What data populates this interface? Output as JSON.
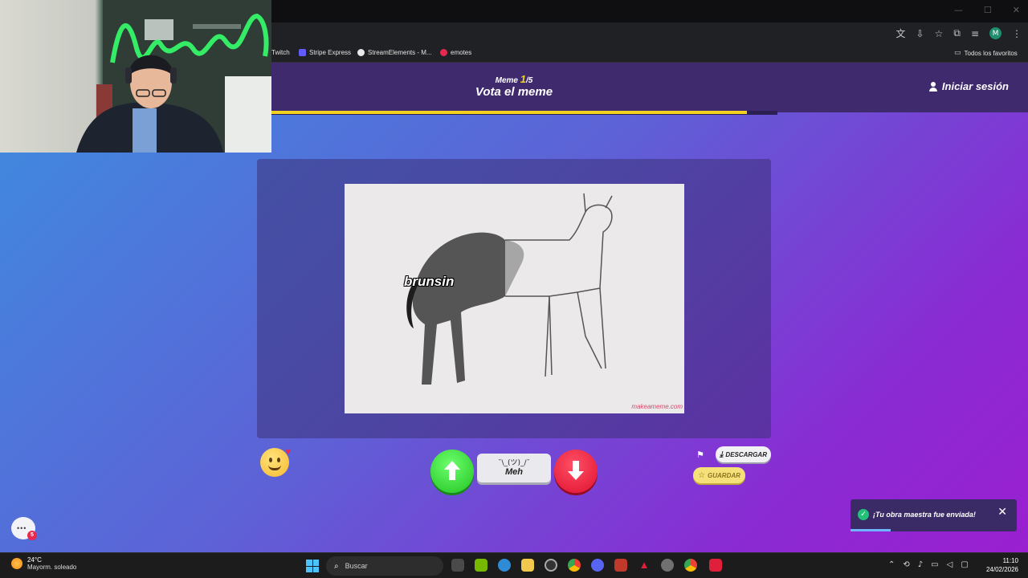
{
  "bookmarks": [
    {
      "label": "Twitch",
      "color": "#9146ff"
    },
    {
      "label": "Stripe Express",
      "color": "#635bff"
    },
    {
      "label": "StreamElements - M...",
      "color": "#e9e9e9"
    },
    {
      "label": "emotes",
      "color": "#e8294f"
    }
  ],
  "all_bookmarks": "Todos los favoritos",
  "profile_initial": "M",
  "header": {
    "counter_prefix": "Meme",
    "counter_current": "1",
    "counter_total": "/5",
    "title": "Vota el meme",
    "login": "Iniciar sesión",
    "progress": 0.94
  },
  "meme": {
    "caption": "brunsin",
    "watermark": "makeameme.com"
  },
  "vote": {
    "meh_shrug": "¯\\_(ツ)_/¯",
    "meh_label": "Meh"
  },
  "actions": {
    "download": "DESCARGAR",
    "save": "GUARDAR"
  },
  "toast": {
    "message": "¡Tu obra maestra fue enviada!",
    "progress": 0.24
  },
  "chat_badge": "5",
  "taskbar": {
    "temp": "24°C",
    "condition": "Mayorm. soleado",
    "search": "Buscar",
    "time": "11:10",
    "date": "24/02/2026"
  },
  "colors": {
    "accent_yellow": "#f2d21e",
    "up_green": "#22c322",
    "down_red": "#e0102e",
    "header_purple": "#3f2a6e"
  }
}
